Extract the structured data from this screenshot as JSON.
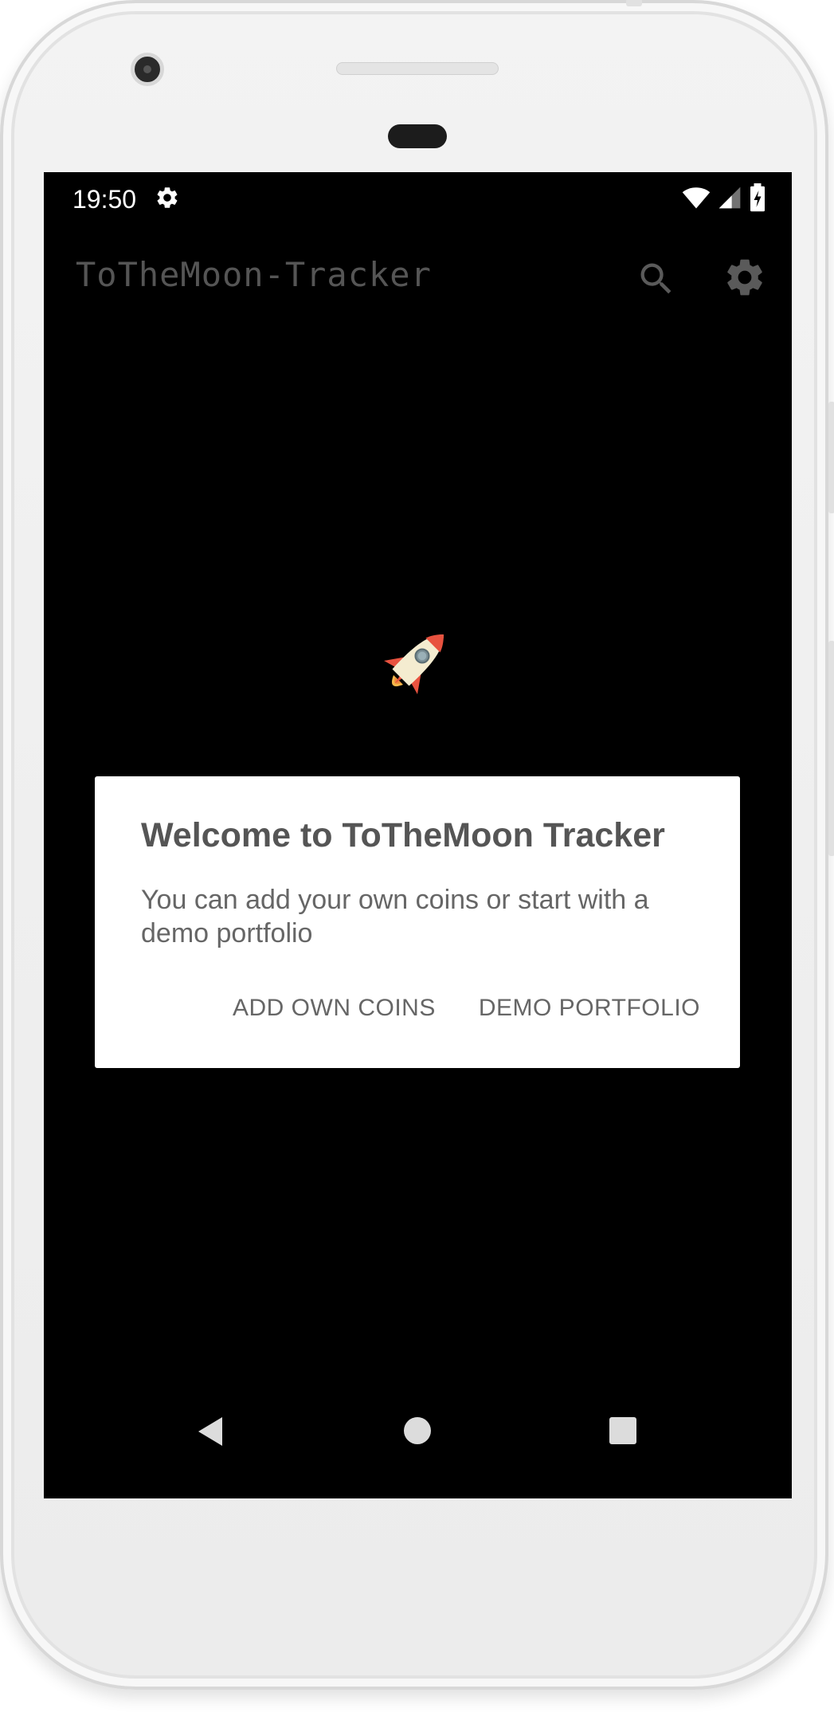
{
  "status_bar": {
    "time": "19:50",
    "settings_icon": "gear-icon",
    "wifi_icon": "wifi-icon",
    "signal_icon": "cell-signal-icon",
    "battery_icon": "battery-charging-icon"
  },
  "app_bar": {
    "title": "ToTheMoon-Tracker",
    "search_icon": "search-icon",
    "settings_icon": "settings-gear-icon"
  },
  "splash": {
    "icon": "rocket-icon"
  },
  "dialog": {
    "title": "Welcome to ToTheMoon Tracker",
    "message": "You can add your own coins or start with a demo portfolio",
    "add_own_coins_label": "ADD OWN COINS",
    "demo_portfolio_label": "DEMO PORTFOLIO"
  },
  "nav_bar": {
    "back_icon": "back-triangle-icon",
    "home_icon": "home-circle-icon",
    "recents_icon": "recents-square-icon"
  },
  "colors": {
    "screen_background": "#000000",
    "dialog_background": "#ffffff",
    "text_gray": "#555555",
    "rocket_body": "#f4ecd0",
    "rocket_fin": "#e8523f"
  }
}
